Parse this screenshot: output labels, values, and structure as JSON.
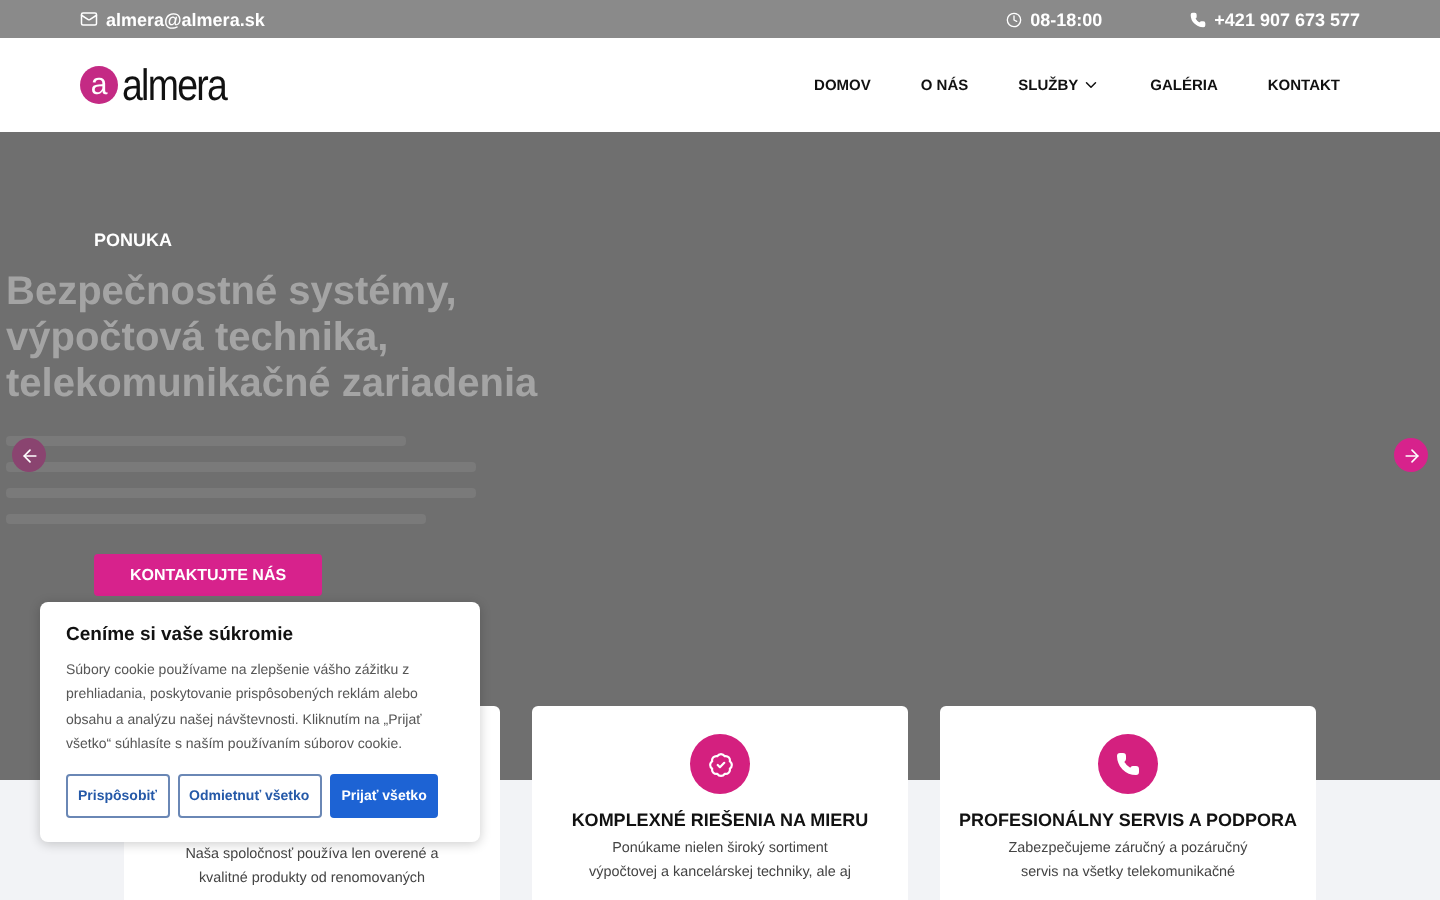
{
  "topbar": {
    "email": "almera@almera.sk",
    "hours": "08-18:00",
    "phone": "+421 907 673 577"
  },
  "logo": {
    "mark": "a",
    "name": "almera"
  },
  "nav": [
    {
      "label": "DOMOV",
      "dropdown": false
    },
    {
      "label": "O NÁS",
      "dropdown": false
    },
    {
      "label": "SLUŽBY",
      "dropdown": true
    },
    {
      "label": "GALÉRIA",
      "dropdown": false
    },
    {
      "label": "KONTAKT",
      "dropdown": false
    }
  ],
  "hero": {
    "eyebrow": "PONUKA",
    "headline": [
      "Bezpečnostné systémy,",
      "výpočtová technika,",
      "telekomunikačné zariadenia"
    ],
    "button": "KONTAKTUJTE NÁS"
  },
  "cards": [
    {
      "kind": "text",
      "lines": [
        "Naša spoločnosť používa len overené a",
        "kvalitné produkty od renomovaných"
      ]
    },
    {
      "kind": "badge",
      "title": "KOMPLEXNÉ RIEŠENIA NA MIERU",
      "lines": [
        "Ponúkame nielen široký sortiment",
        "výpočtovej a kancelárskej techniky, ale aj"
      ]
    },
    {
      "kind": "phone",
      "title": "PROFESIONÁLNY SERVIS A PODPORA",
      "lines": [
        "Zabezpečujeme záručný a pozáručný",
        "servis na všetky telekomunikačné"
      ]
    }
  ],
  "cookie": {
    "title": "Ceníme si vaše súkromie",
    "text": "Súbory cookie používame na zlepšenie vášho zážitku z prehliadania, poskytovanie prispôsobených reklám alebo obsahu a analýzu našej návštevnosti. Kliknutím na „Prijať všetko“ súhlasíte s naším používaním súborov cookie.",
    "buttons": [
      {
        "label": "Prispôsobiť",
        "primary": false
      },
      {
        "label": "Odmietnuť všetko",
        "primary": false
      },
      {
        "label": "Prijať všetko",
        "primary": true
      }
    ]
  }
}
